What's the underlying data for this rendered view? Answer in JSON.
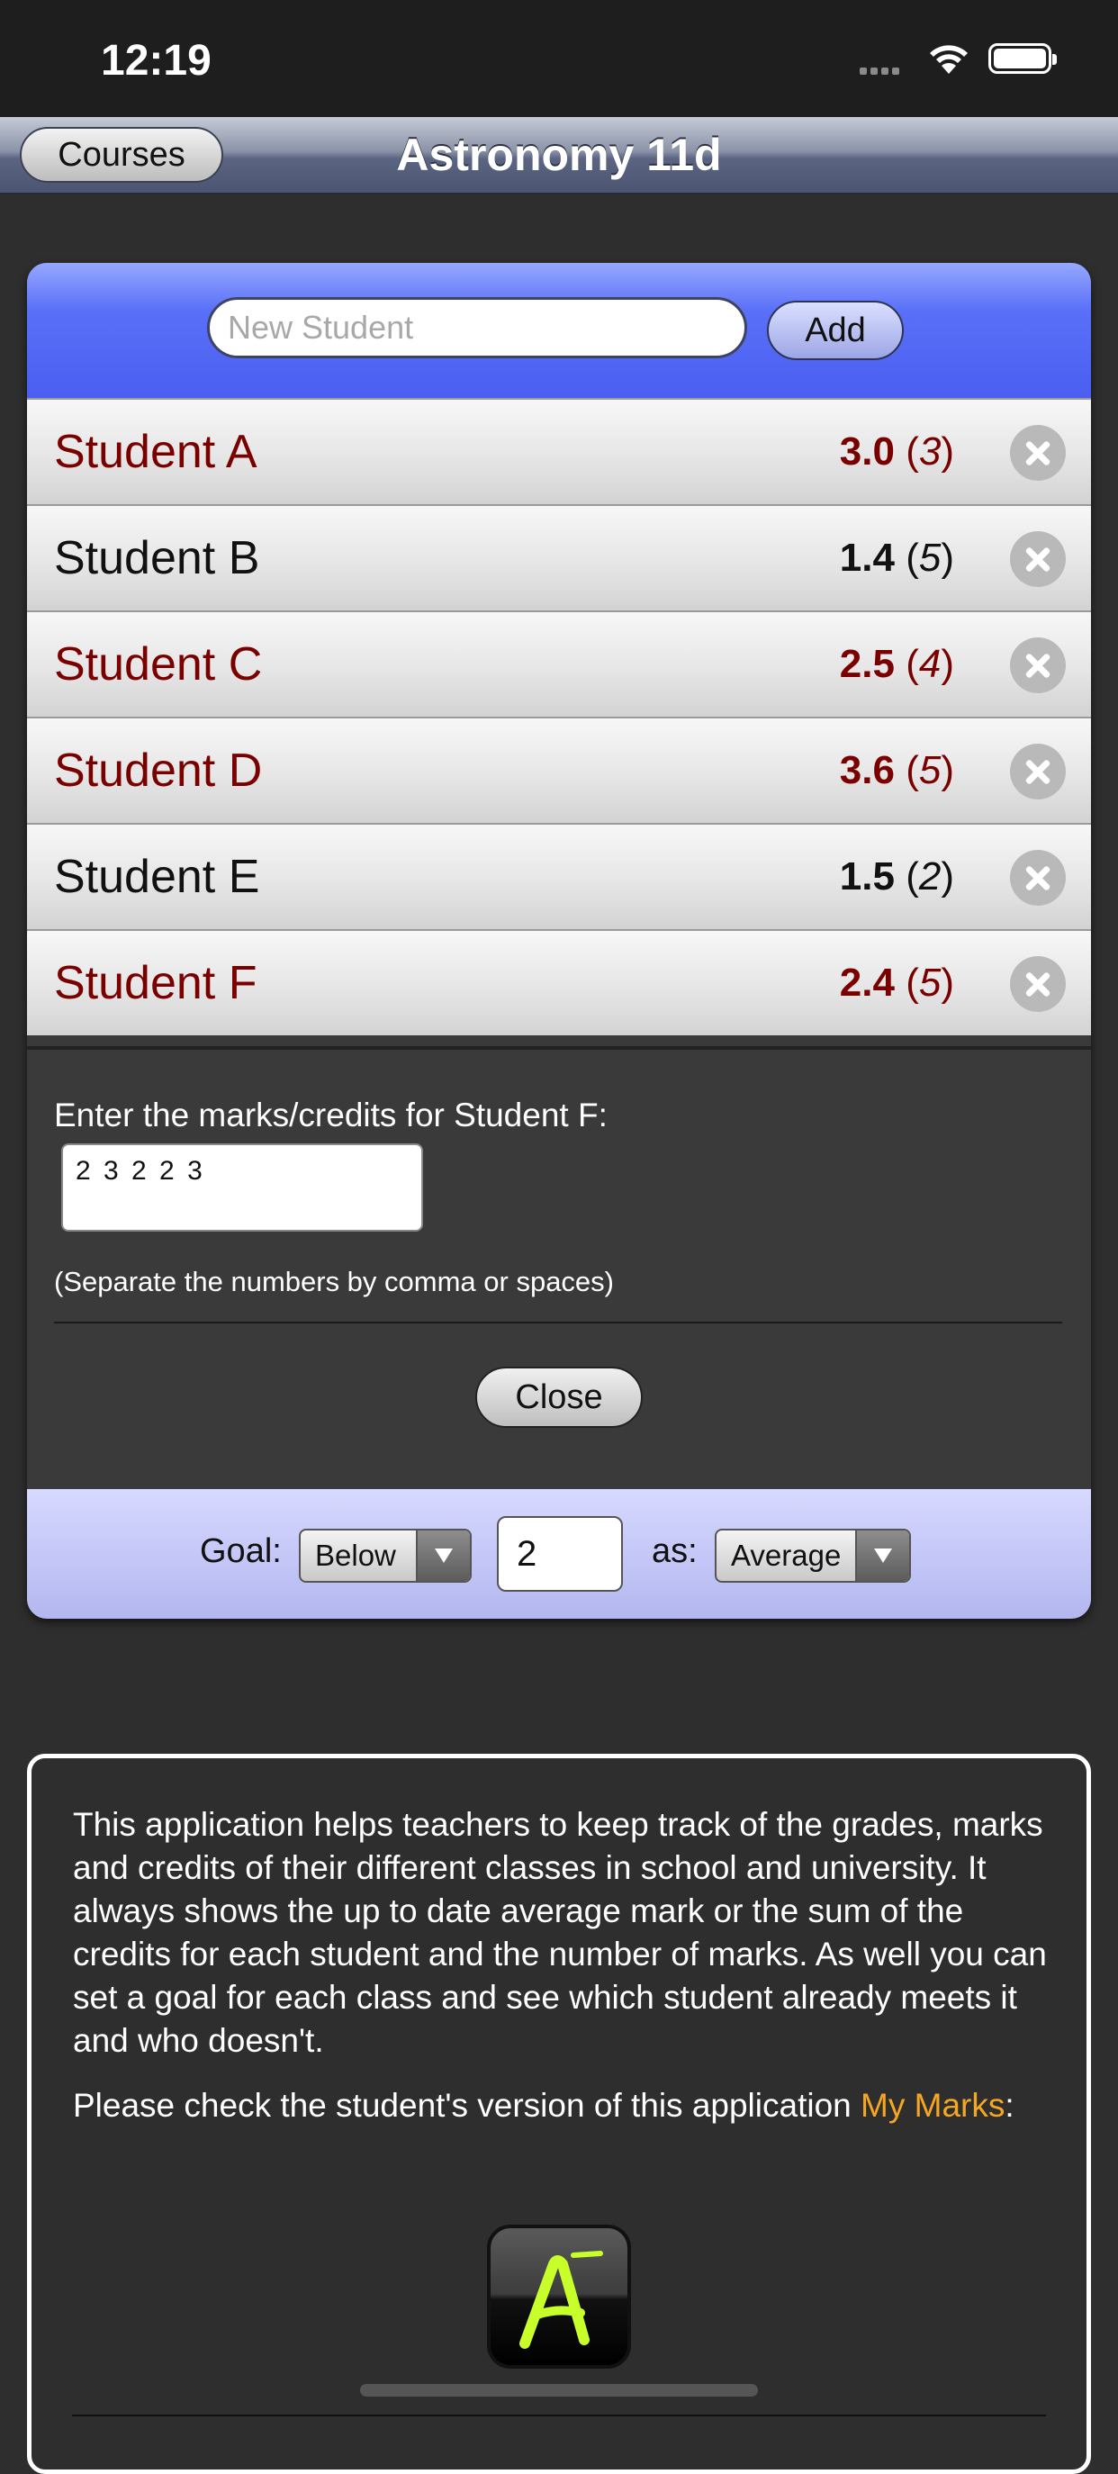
{
  "status_bar": {
    "time": "12:19"
  },
  "nav": {
    "back_label": "Courses",
    "title": "Astronomy 11d"
  },
  "add_student": {
    "placeholder": "New Student",
    "add_label": "Add"
  },
  "students": [
    {
      "name": "Student A",
      "average": "3.0",
      "count": "3",
      "meets_goal": false
    },
    {
      "name": "Student B",
      "average": "1.4",
      "count": "5",
      "meets_goal": true
    },
    {
      "name": "Student C",
      "average": "2.5",
      "count": "4",
      "meets_goal": false
    },
    {
      "name": "Student D",
      "average": "3.6",
      "count": "5",
      "meets_goal": false
    },
    {
      "name": "Student E",
      "average": "1.5",
      "count": "2",
      "meets_goal": true
    },
    {
      "name": "Student F",
      "average": "2.4",
      "count": "5",
      "meets_goal": false
    }
  ],
  "editor": {
    "label": "Enter the marks/credits for Student F:",
    "marks_value": "2 3 2 2 3",
    "hint": "(Separate the numbers by comma or spaces)",
    "close_label": "Close"
  },
  "goal": {
    "goal_label": "Goal:",
    "direction": "Below",
    "value": "2",
    "as_label": "as:",
    "mode": "Average"
  },
  "info": {
    "paragraph1": "This application helps teachers to keep track of the grades, marks and credits of their different classes in school and university. It always shows the up to date average mark or the sum of the credits for each student and the number of marks. As well you can set a goal for each class and see which student already meets it and who doesn't.",
    "paragraph2_prefix": "Please check the student's version of this application ",
    "link_text": "My Marks",
    "paragraph2_suffix": ":"
  },
  "colors": {
    "below_goal_text": "#7a0000",
    "meets_goal_text": "#111111",
    "header_blue": "#5a70f8",
    "link_orange": "#f5a623"
  },
  "icons": {
    "delete": "circle-x-icon",
    "app_icon": "my-marks-a-minus-icon"
  }
}
